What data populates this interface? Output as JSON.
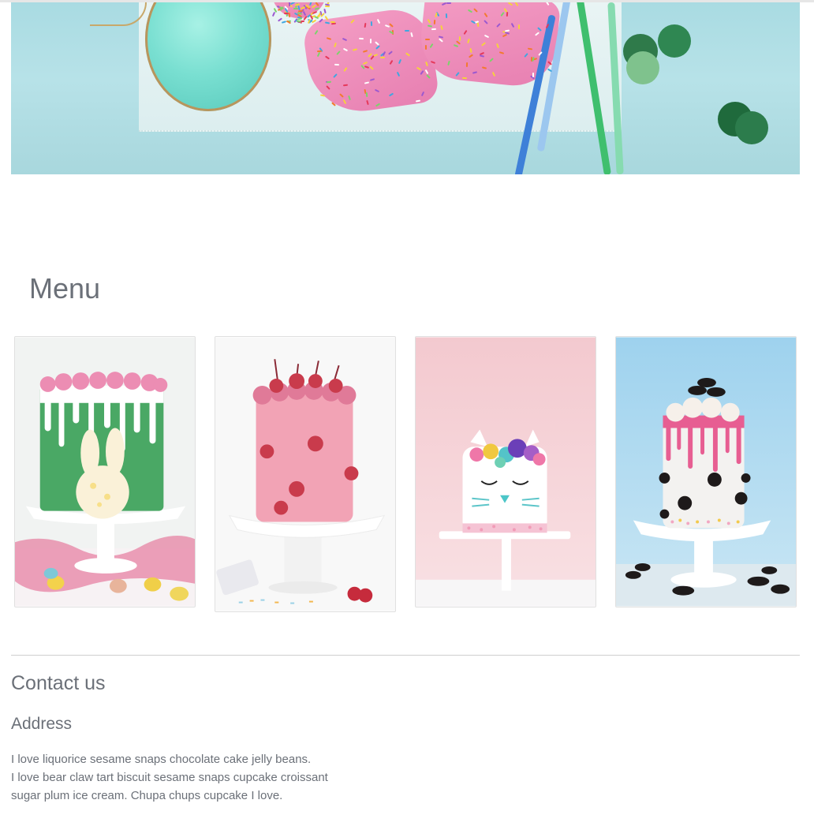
{
  "hero": {
    "image": "party-cake-slices-photo"
  },
  "menu": {
    "heading": "Menu",
    "cakes": [
      {
        "image": "green-bunny-drip-cake"
      },
      {
        "image": "pink-cherry-cake"
      },
      {
        "image": "white-cat-unicorn-cake"
      },
      {
        "image": "oreo-drip-cake"
      }
    ]
  },
  "contact": {
    "heading": "Contact us",
    "address_heading": "Address",
    "address_lines": [
      "I love liquorice sesame snaps chocolate cake jelly beans.",
      "I love bear claw tart biscuit sesame snaps cupcake croissant",
      "sugar plum ice cream. Chupa chups cupcake I love."
    ]
  },
  "colors": {
    "text": "#6b7078",
    "divider": "#cfcfcf",
    "hero_background": "#a9dbe2"
  }
}
